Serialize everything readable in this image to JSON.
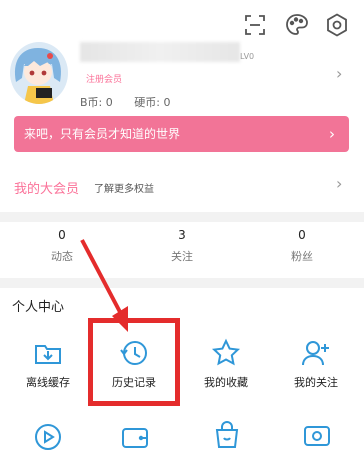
{
  "header": {
    "icons": [
      "scan-icon",
      "palette-icon",
      "settings-icon"
    ]
  },
  "profile": {
    "level": "LV0",
    "member_tag": "注册会员",
    "b_coin_label": "B币: 0",
    "coin_label": "硬币: 0"
  },
  "banner": {
    "text": "来吧，只有会员才知道的世界"
  },
  "vip": {
    "title": "我的大会员",
    "subtitle": "了解更多权益"
  },
  "stats": [
    {
      "count": "0",
      "label": "动态"
    },
    {
      "count": "3",
      "label": "关注"
    },
    {
      "count": "0",
      "label": "粉丝"
    }
  ],
  "personal_center": {
    "title": "个人中心",
    "items": [
      {
        "label": "离线缓存",
        "icon": "download-folder-icon"
      },
      {
        "label": "历史记录",
        "icon": "history-clock-icon"
      },
      {
        "label": "我的收藏",
        "icon": "star-icon"
      },
      {
        "label": "我的关注",
        "icon": "add-user-icon"
      }
    ],
    "row2_icons": [
      "play-circle-icon",
      "wallet-icon",
      "shopping-bag-icon",
      "tv-icon"
    ]
  },
  "colors": {
    "pink": "#fb7299",
    "banner": "#f27497",
    "highlight": "#e42c2c"
  }
}
